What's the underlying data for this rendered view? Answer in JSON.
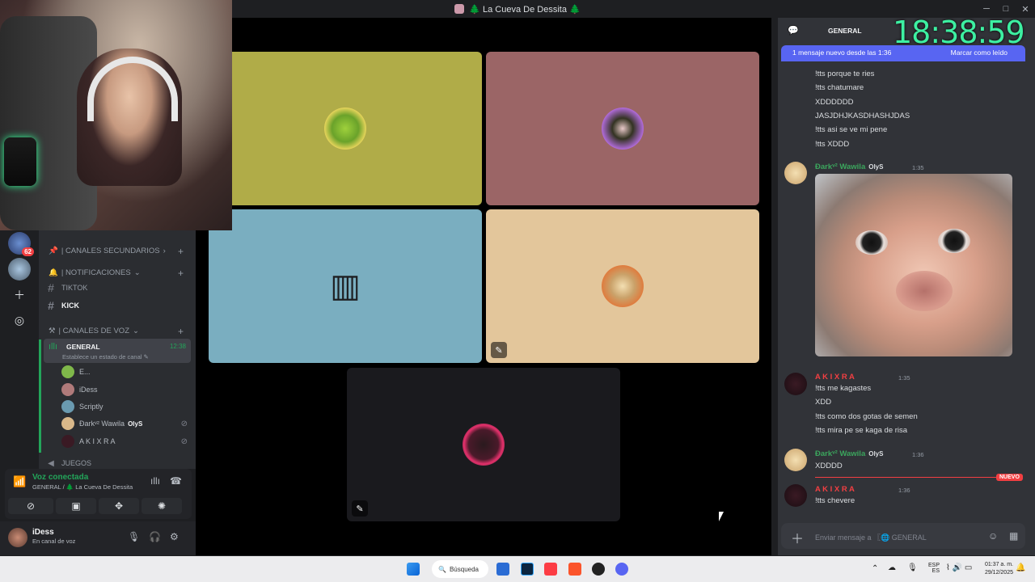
{
  "window": {
    "title": "🌲 La Cueva De Dessita 🌲",
    "controls": [
      "─",
      "□",
      "✕"
    ]
  },
  "clock": "18:38:59",
  "servers": {
    "badge": "62"
  },
  "channels": {
    "categories": [
      {
        "label": "| CANALES SECUNDARIOS",
        "chev": "›"
      },
      {
        "label": "| NOTIFICACIONES",
        "chev": "⌄"
      },
      {
        "label": "| CANALES DE VOZ",
        "chev": "⌄"
      }
    ],
    "text_channels": [
      {
        "label": "TIKTOK"
      },
      {
        "label": "KICK"
      }
    ],
    "voice_channel": {
      "name": "GENERAL",
      "status": "Establece un estado de canal ✎",
      "time": "12:38"
    },
    "members": [
      "E...",
      "iDess",
      "Scriptly",
      "Ðarkᵛ² Wawila",
      "A K I X R A"
    ],
    "member_tag": "OlyS",
    "next_channel": "JUEGOS"
  },
  "voice_panel": {
    "title": "Voz conectada",
    "subtitle": "GENERAL / 🌲 La Cueva De Dessita"
  },
  "user": {
    "name": "iDess",
    "status": "En canal de voz"
  },
  "chat": {
    "channel": "GENERAL",
    "banner_left": "1 mensaje nuevo desde las 1:36",
    "banner_right": "Marcar como leído",
    "lines_top": [
      "!tts porque te ries",
      "!tts chatumare",
      "XDDDDDD",
      "JASJDHJKASDHASHJDAS",
      "!tts asi se ve mi pene",
      "!tts XDDD"
    ],
    "m1_author": "Ðarkᵛ² Wawila",
    "m1_tag": "OlyS",
    "m1_time": "1:35",
    "m2_author": "A K I X R A",
    "m2_time": "1:35",
    "m2_lines": [
      "!tts me kagastes",
      "XDD",
      "!tts como dos gotas de semen",
      "!tts mira pe se kaga de risa"
    ],
    "m3_author": "Ðarkᵛ² Wawila",
    "m3_time": "1:36",
    "m3_line": "XDDDD",
    "new_label": "NUEVO",
    "m4_author": "A K I X R A",
    "m4_time": "1:36",
    "m4_line": "!tts chevere",
    "input_placeholder": "Enviar mensaje a 〖🌐 GENERAL"
  },
  "taskbar": {
    "search": "Búsqueda",
    "lang": "ESP ES",
    "time": "01:37 a. m.",
    "date": "29/12/2025"
  }
}
